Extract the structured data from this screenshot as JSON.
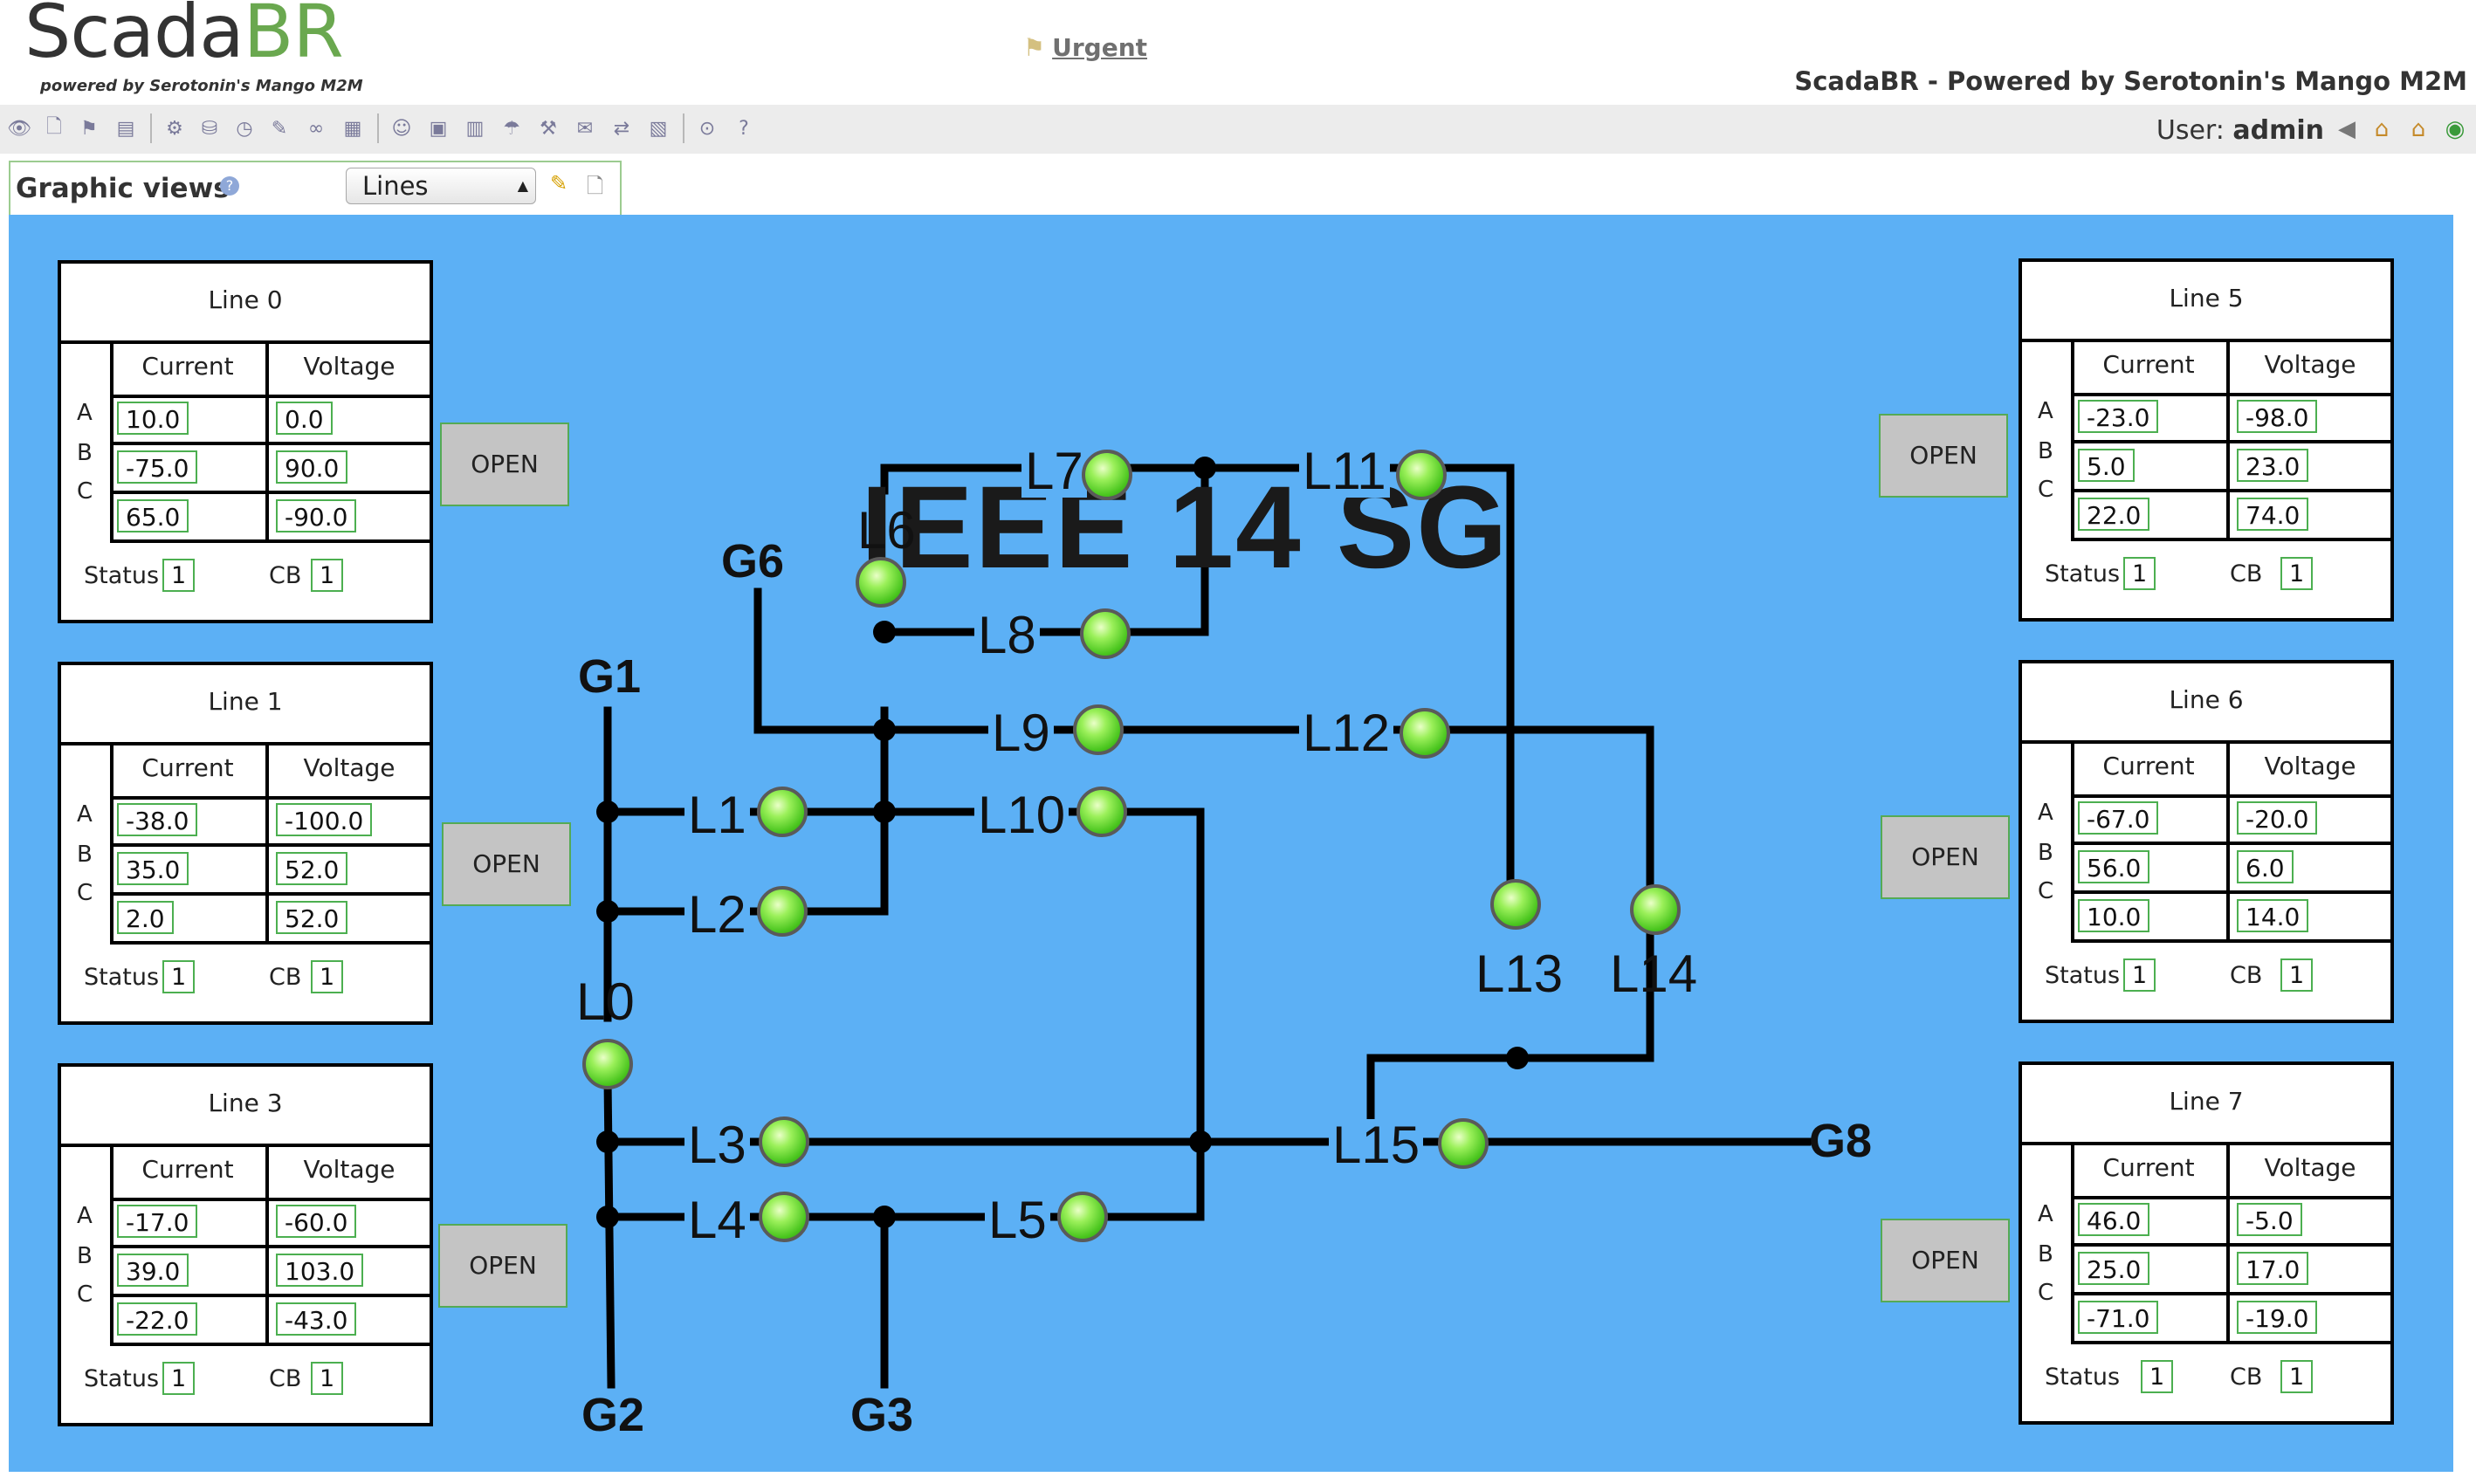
{
  "header": {
    "logo_text_a": "Scada",
    "logo_text_b": "BR",
    "logo_tagline": "powered by Serotonin's Mango M2M",
    "urgent_label": "Urgent",
    "app_title": "ScadaBR - Powered by Serotonin's Mango M2M",
    "user_label": "User:",
    "user_name": "admin"
  },
  "toolbar": {
    "icons": [
      "watch-list-icon",
      "new-document-icon",
      "alarms-icon",
      "reports-icon",
      "data-sources-icon",
      "data-points-icon",
      "scheduled-events-icon",
      "compound-events-icon",
      "point-links-icon",
      "scripts-icon",
      "users-icon",
      "user-profiles-icon",
      "sql-icon",
      "maintenance-icon",
      "tools-icon",
      "mailing-lists-icon",
      "publishers-icon",
      "system-settings-icon",
      "logout-icon",
      "help-icon"
    ]
  },
  "graphic_views": {
    "label": "Graphic views",
    "selected_view": "Lines"
  },
  "diagram": {
    "title": "IEEE 14 SG",
    "generators": [
      "G1",
      "G2",
      "G3",
      "G6",
      "G8"
    ],
    "line_labels": [
      "L0",
      "L1",
      "L2",
      "L3",
      "L4",
      "L5",
      "L6",
      "L7",
      "L8",
      "L9",
      "L10",
      "L11",
      "L12",
      "L13",
      "L14",
      "L15"
    ]
  },
  "panels": [
    {
      "title": "Line 0",
      "col_current": "Current",
      "col_voltage": "Voltage",
      "phases": [
        "A",
        "B",
        "C"
      ],
      "current": [
        "10.0",
        "-75.0",
        "65.0"
      ],
      "voltage": [
        "0.0",
        "90.0",
        "-90.0"
      ],
      "status_label": "Status",
      "status": "1",
      "cb_label": "CB",
      "cb": "1",
      "button": "OPEN"
    },
    {
      "title": "Line 1",
      "col_current": "Current",
      "col_voltage": "Voltage",
      "phases": [
        "A",
        "B",
        "C"
      ],
      "current": [
        "-38.0",
        "35.0",
        "2.0"
      ],
      "voltage": [
        "-100.0",
        "52.0",
        "52.0"
      ],
      "status_label": "Status",
      "status": "1",
      "cb_label": "CB",
      "cb": "1",
      "button": "OPEN"
    },
    {
      "title": "Line 3",
      "col_current": "Current",
      "col_voltage": "Voltage",
      "phases": [
        "A",
        "B",
        "C"
      ],
      "current": [
        "-17.0",
        "39.0",
        "-22.0"
      ],
      "voltage": [
        "-60.0",
        "103.0",
        "-43.0"
      ],
      "status_label": "Status",
      "status": "1",
      "cb_label": "CB",
      "cb": "1",
      "button": "OPEN"
    },
    {
      "title": "Line 5",
      "col_current": "Current",
      "col_voltage": "Voltage",
      "phases": [
        "A",
        "B",
        "C"
      ],
      "current": [
        "-23.0",
        "5.0",
        "22.0"
      ],
      "voltage": [
        "-98.0",
        "23.0",
        "74.0"
      ],
      "status_label": "Status",
      "status": "1",
      "cb_label": "CB",
      "cb": "1",
      "button": "OPEN"
    },
    {
      "title": "Line 6",
      "col_current": "Current",
      "col_voltage": "Voltage",
      "phases": [
        "A",
        "B",
        "C"
      ],
      "current": [
        "-67.0",
        "56.0",
        "10.0"
      ],
      "voltage": [
        "-20.0",
        "6.0",
        "14.0"
      ],
      "status_label": "Status",
      "status": "1",
      "cb_label": "CB",
      "cb": "1",
      "button": "OPEN"
    },
    {
      "title": "Line 7",
      "col_current": "Current",
      "col_voltage": "Voltage",
      "phases": [
        "A",
        "B",
        "C"
      ],
      "current": [
        "46.0",
        "25.0",
        "-71.0"
      ],
      "voltage": [
        "-5.0",
        "17.0",
        "-19.0"
      ],
      "status_label": "Status",
      "status": "1",
      "cb_label": "CB",
      "cb": "1",
      "button": "OPEN"
    }
  ],
  "colors": {
    "canvas_bg": "#5cb0f5",
    "led_on": "#49c51e",
    "value_border": "#4caf50",
    "logo_accent": "#6aa84f"
  }
}
